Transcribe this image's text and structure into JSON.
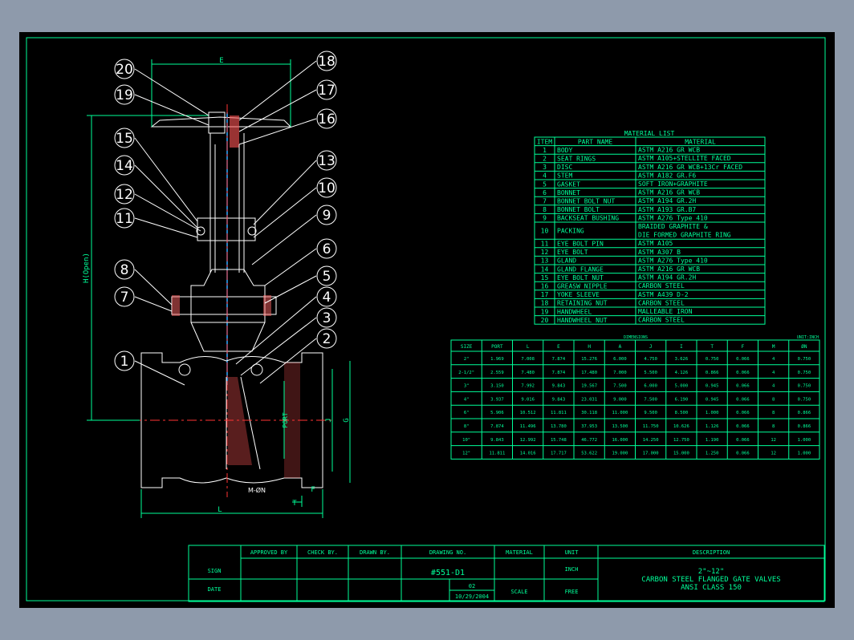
{
  "drawing": {
    "callouts": [
      "1",
      "2",
      "3",
      "4",
      "5",
      "6",
      "7",
      "8",
      "9",
      "10",
      "11",
      "12",
      "13",
      "14",
      "15",
      "16",
      "17",
      "18",
      "19",
      "20"
    ],
    "dim_labels": {
      "E": "E",
      "H": "H(Open)",
      "L": "L",
      "J": "J",
      "G": "G",
      "F": "F",
      "T": "T",
      "port": "PORT",
      "mn": "M-ØN"
    }
  },
  "material_list": {
    "title": "MATERIAL LIST",
    "headers": [
      "ITEM",
      "PART NAME",
      "MATERIAL"
    ],
    "rows": [
      [
        "1",
        "BODY",
        "ASTM A216 GR WCB"
      ],
      [
        "2",
        "SEAT RINGS",
        "ASTM A105+STELLITE FACED"
      ],
      [
        "3",
        "DISC",
        "ASTM A216 GR WCB+13Cr FACED"
      ],
      [
        "4",
        "STEM",
        "ASTM A182 GR.F6"
      ],
      [
        "5",
        "GASKET",
        "SOFT IRON+GRAPHITE"
      ],
      [
        "6",
        "BONNET",
        "ASTM A216 GR WCB"
      ],
      [
        "7",
        "BONNET BOLT NUT",
        "ASTM A194 GR.2H"
      ],
      [
        "8",
        "BONNET BOLT",
        "ASTM A193 GR.B7"
      ],
      [
        "9",
        "BACKSEAT BUSHING",
        "ASTM A276 Type 410"
      ],
      [
        "10",
        "PACKING",
        "BRAIDED GRAPHITE &",
        "DIE FORMED GRAPHITE RING"
      ],
      [
        "11",
        "EYE BOLT PIN",
        "ASTM A105"
      ],
      [
        "12",
        "EYE BOLT",
        "ASTM A307 B"
      ],
      [
        "13",
        "GLAND",
        "ASTM A276 Type 410"
      ],
      [
        "14",
        "GLAND FLANGE",
        "ASTM A216 GR WCB"
      ],
      [
        "15",
        "EYE BOLT NUT",
        "ASTM A194 GR.2H"
      ],
      [
        "16",
        "GREASW NIPPLE",
        "CARBON STEEL"
      ],
      [
        "17",
        "YOKE SLEEVE",
        "ASTM A439 D-2"
      ],
      [
        "18",
        "RETAINING NUT",
        "CARBON STEEL"
      ],
      [
        "19",
        "HANDWHEEL",
        "MALLEABLE IRON"
      ],
      [
        "20",
        "HANDWHEEL NUT",
        "CARBON STEEL"
      ]
    ]
  },
  "dimensions": {
    "title": "DIMENSIONS",
    "unit": "UNIT:INCH",
    "headers": [
      "SIZE",
      "PORT",
      "L",
      "E",
      "H",
      "A",
      "J",
      "I",
      "T",
      "F",
      "M",
      "ØN"
    ],
    "rows": [
      [
        "2\"",
        "1.969",
        "7.008",
        "7.874",
        "15.276",
        "6.000",
        "4.750",
        "3.626",
        "0.750",
        "0.066",
        "4",
        "0.750"
      ],
      [
        "2-1/2\"",
        "2.559",
        "7.480",
        "7.874",
        "17.480",
        "7.000",
        "5.500",
        "4.126",
        "0.866",
        "0.066",
        "4",
        "0.750"
      ],
      [
        "3\"",
        "3.150",
        "7.992",
        "9.843",
        "19.567",
        "7.500",
        "6.000",
        "5.000",
        "0.945",
        "0.066",
        "4",
        "0.750"
      ],
      [
        "4\"",
        "3.937",
        "9.016",
        "9.843",
        "23.031",
        "9.000",
        "7.500",
        "6.190",
        "0.945",
        "0.066",
        "8",
        "0.750"
      ],
      [
        "6\"",
        "5.906",
        "10.512",
        "11.811",
        "30.118",
        "11.000",
        "9.500",
        "8.500",
        "1.000",
        "0.066",
        "8",
        "0.866"
      ],
      [
        "8\"",
        "7.874",
        "11.496",
        "13.780",
        "37.953",
        "13.500",
        "11.750",
        "10.626",
        "1.126",
        "0.066",
        "8",
        "0.866"
      ],
      [
        "10\"",
        "9.843",
        "12.992",
        "15.748",
        "46.772",
        "16.000",
        "14.250",
        "12.750",
        "1.190",
        "0.066",
        "12",
        "1.000"
      ],
      [
        "12\"",
        "11.811",
        "14.016",
        "17.717",
        "53.622",
        "19.000",
        "17.000",
        "15.000",
        "1.250",
        "0.066",
        "12",
        "1.000"
      ]
    ]
  },
  "title_block": {
    "row_labels": [
      "SIGN",
      "DATE"
    ],
    "headers": [
      "APPROVED BY",
      "CHECK BY.",
      "DRAWN BY.",
      "DRAWING NO.",
      "MATERIAL",
      "UNIT",
      "DESCRIPTION"
    ],
    "drawing_no": "#551-D1",
    "unit_value": "INCH",
    "rev": "02",
    "date": "10/29/2004",
    "scale_label": "SCALE",
    "scale_value": "FREE",
    "description": [
      "2\"~12\"",
      "CARBON STEEL FLANGED GATE VALVES",
      "ANSI CLASS 150"
    ]
  },
  "colors": {
    "sheet": "#000000",
    "line": "#00ff99",
    "part": "#ffffff",
    "background": "#8e9aab",
    "center": "#ff3333"
  }
}
